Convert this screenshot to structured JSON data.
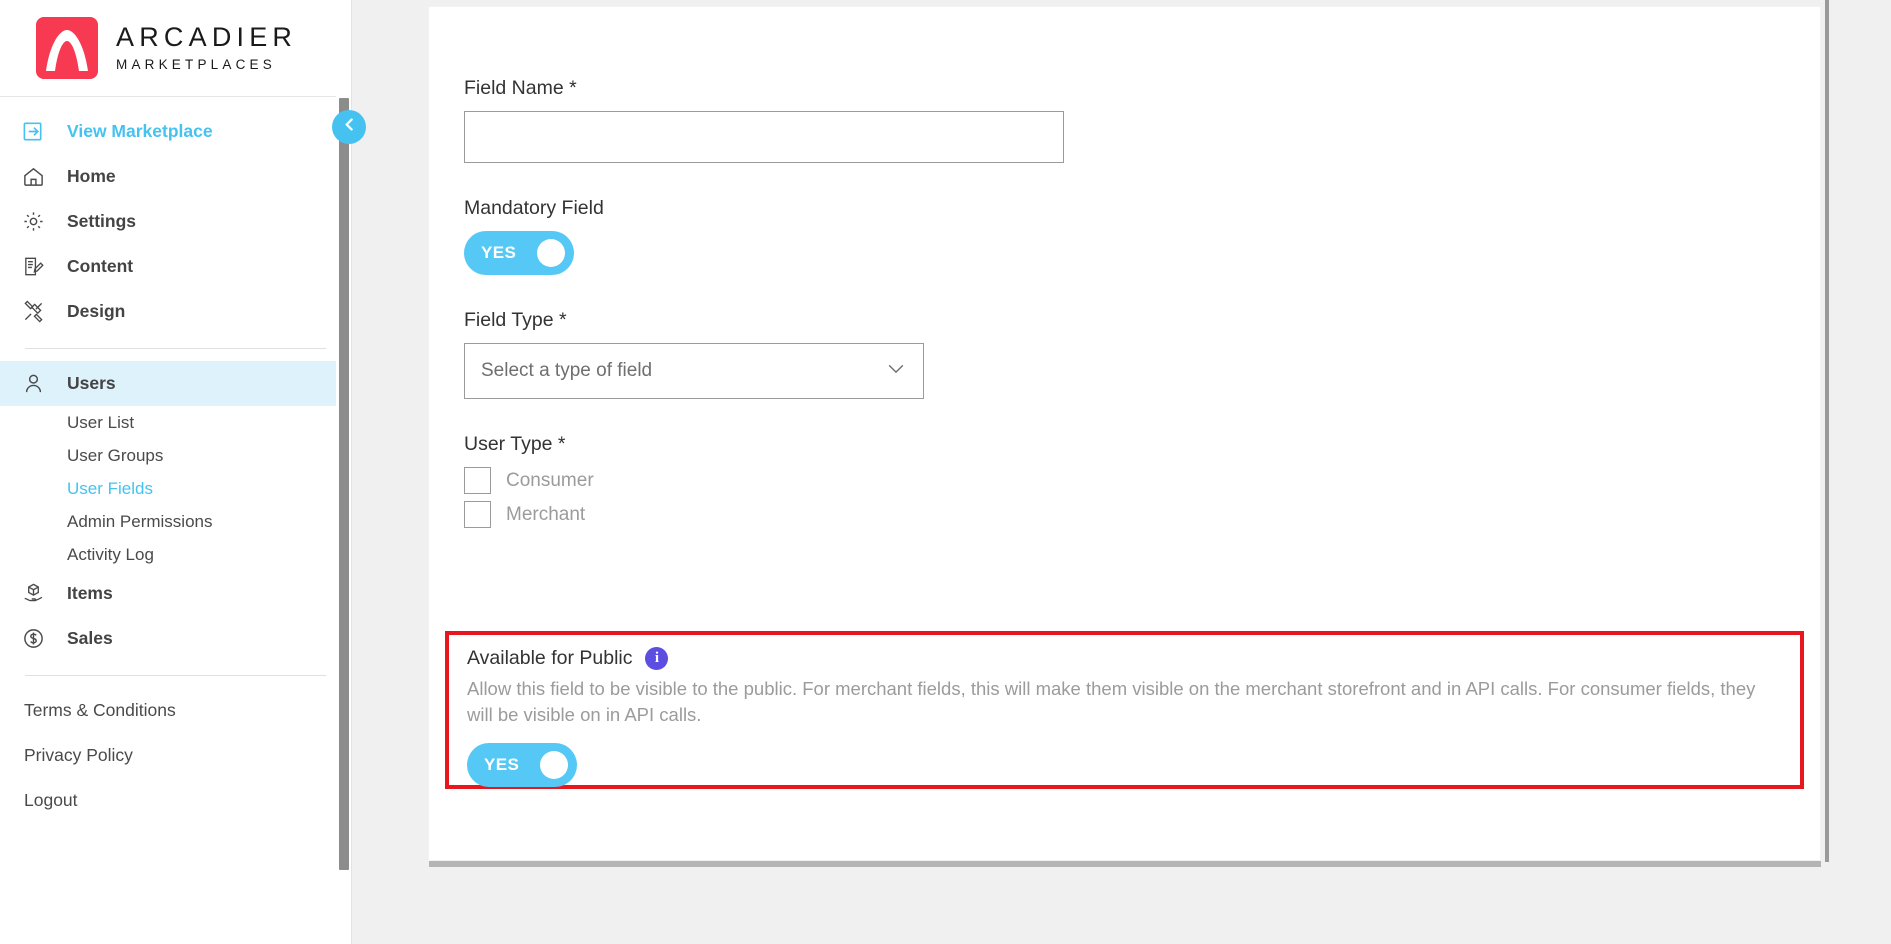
{
  "brand": {
    "name": "ARCADIER",
    "tagline": "MARKETPLACES",
    "logo_color": "#f73a52"
  },
  "sidebar": {
    "collapse_button": "collapse-sidebar",
    "primary": [
      {
        "label": "View Marketplace",
        "icon": "external-link-icon",
        "accent": true
      },
      {
        "label": "Home",
        "icon": "home-icon",
        "accent": false
      },
      {
        "label": "Settings",
        "icon": "gear-icon",
        "accent": false
      },
      {
        "label": "Content",
        "icon": "content-edit-icon",
        "accent": false
      },
      {
        "label": "Design",
        "icon": "design-tools-icon",
        "accent": false
      }
    ],
    "users": {
      "label": "Users",
      "icon": "user-icon",
      "active": true,
      "sub_items": [
        {
          "label": "User List",
          "selected": false
        },
        {
          "label": "User Groups",
          "selected": false
        },
        {
          "label": "User Fields",
          "selected": true
        },
        {
          "label": "Admin Permissions",
          "selected": false
        },
        {
          "label": "Activity Log",
          "selected": false
        }
      ]
    },
    "secondary": [
      {
        "label": "Items",
        "icon": "package-hand-icon"
      },
      {
        "label": "Sales",
        "icon": "dollar-circle-icon"
      }
    ],
    "footer": [
      {
        "label": "Terms & Conditions"
      },
      {
        "label": "Privacy Policy"
      },
      {
        "label": "Logout"
      }
    ]
  },
  "form": {
    "field_name": {
      "label": "Field Name *",
      "value": "",
      "placeholder": ""
    },
    "mandatory_field": {
      "label": "Mandatory Field",
      "toggle_text": "YES",
      "state": "on"
    },
    "field_type": {
      "label": "Field Type *",
      "selected": "Select a type of field",
      "arrow_icon": "chevron-down-icon"
    },
    "user_type": {
      "label": "User Type *",
      "options": [
        {
          "label": "Consumer",
          "checked": false
        },
        {
          "label": "Merchant",
          "checked": false
        }
      ]
    },
    "available_for_public": {
      "label": "Available for Public",
      "info_icon": "info-icon",
      "info_glyph": "i",
      "description": "Allow this field to be visible to the public. For merchant fields, this will make them visible on the merchant storefront and in API calls. For consumer fields, they will be visible on in API calls.",
      "toggle_text": "YES",
      "state": "on",
      "highlight_color": "#e8161d"
    }
  },
  "colors": {
    "accent": "#45c2f0",
    "toggle_on": "#55c8f5",
    "active_row": "#ddf2fb",
    "info_badge": "#5b4ee0",
    "highlight": "#e8161d"
  }
}
